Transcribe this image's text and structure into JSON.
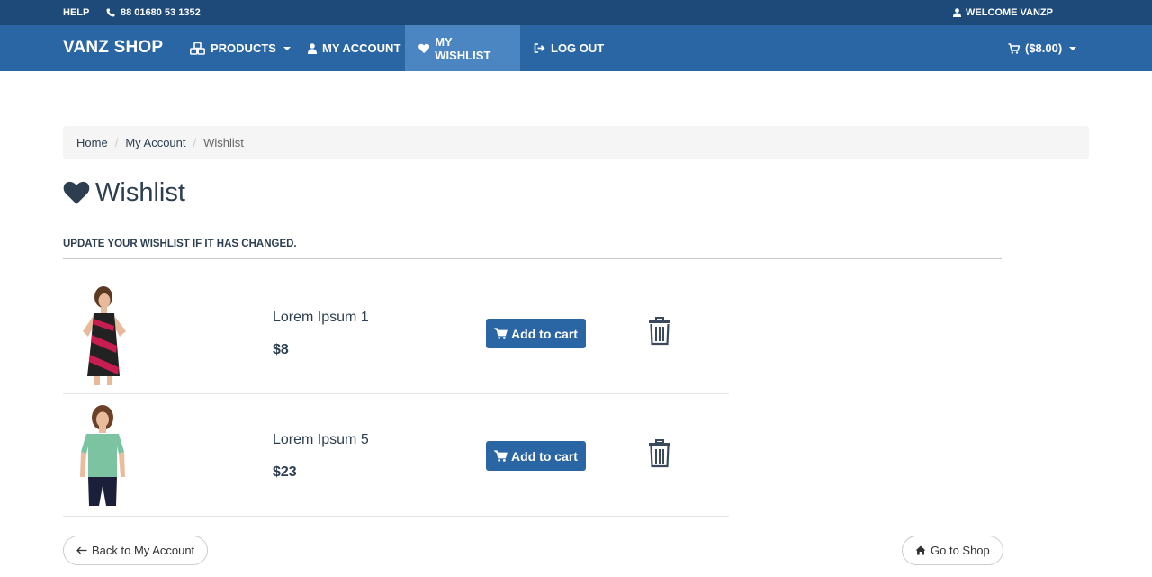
{
  "topbar": {
    "help": "HELP",
    "phone": "88 01680 53 1352",
    "welcome": "WELCOME VANZP"
  },
  "nav": {
    "brand": "VANZ SHOP",
    "products": "PRODUCTS",
    "account": "MY ACCOUNT",
    "wishlist": "MY WISHLIST",
    "logout": "LOG OUT",
    "cart": "($8.00)"
  },
  "breadcrumb": {
    "home": "Home",
    "account": "My Account",
    "current": "Wishlist"
  },
  "page": {
    "title": "Wishlist",
    "instruction": "UPDATE YOUR WISHLIST IF IT HAS CHANGED."
  },
  "items": [
    {
      "name": "Lorem Ipsum 1",
      "price": "$8",
      "button": "Add to cart"
    },
    {
      "name": "Lorem Ipsum 5",
      "price": "$23",
      "button": "Add to cart"
    }
  ],
  "footer": {
    "back": "Back to My Account",
    "shop": "Go to Shop"
  },
  "colors": {
    "topbar": "#1e4a7a",
    "navbar": "#2a65a4",
    "nav_active": "#4b86c2",
    "accent": "#2a65a4"
  },
  "icons": [
    "phone-icon",
    "user-icon",
    "cubes-icon",
    "heart-icon",
    "sign-out-icon",
    "cart-icon",
    "trash-icon",
    "arrow-left-icon",
    "home-icon"
  ]
}
